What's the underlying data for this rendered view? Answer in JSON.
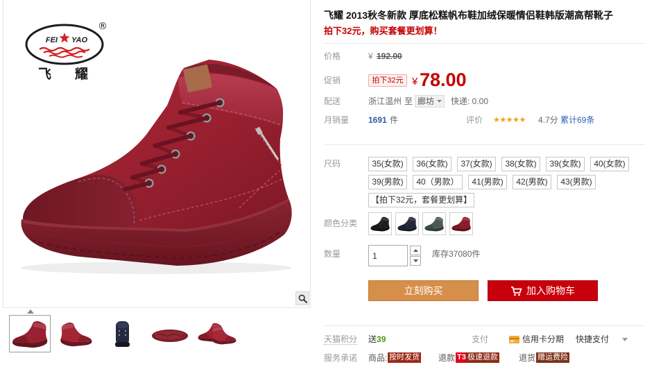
{
  "gallery": {
    "logo": {
      "text_left": "FEI",
      "text_right": "YAO",
      "registered": "®",
      "cn_left": "飞",
      "cn_right": "耀"
    },
    "zoom_icon": "magnifier-icon"
  },
  "product": {
    "title": "飞耀 2013秋冬新款 厚底松糕帆布鞋加绒保暖情侣鞋韩版潮高帮靴子",
    "subtitle": "拍下32元，购买套餐更划算！"
  },
  "price": {
    "label": "价格",
    "currency": "¥",
    "original": "192.00"
  },
  "promo": {
    "label": "促销",
    "badge": "拍下32元",
    "currency": "¥",
    "price": "78.00"
  },
  "delivery": {
    "label": "配送",
    "from": "浙江温州",
    "to": "至",
    "destination": "廊坊",
    "express": "快递: 0.00",
    "dropdown_icon": "chevron-down-icon"
  },
  "sales": {
    "label": "月销量",
    "count": "1691",
    "unit": "件"
  },
  "rating": {
    "label": "评价",
    "stars": "★★★★★",
    "score": "4.7分",
    "reviews": "累计69条"
  },
  "size": {
    "label": "尺码",
    "options": [
      "35(女款)",
      "36(女款)",
      "37(女款)",
      "38(女款)",
      "39(女款)",
      "40(女款)",
      "39(男款)",
      "40（男款）",
      "41(男款)",
      "42(男款)",
      "43(男款)"
    ],
    "package": "【拍下32元，套餐更划算】"
  },
  "color": {
    "label": "颜色分类",
    "swatches": [
      "#1d1d22",
      "#25283c",
      "#4b5a57",
      "#8f1b28"
    ]
  },
  "quantity": {
    "label": "数量",
    "value": "1",
    "stock": "库存37080件"
  },
  "actions": {
    "buy_now": "立刻购买",
    "add_to_cart": "加入购物车",
    "cart_icon": "cart-icon",
    "buy_now_color": "#d68e4b",
    "add_to_cart_color": "#c8000c"
  },
  "points": {
    "label": "天猫积分",
    "prefix": "送",
    "value": "39"
  },
  "payment": {
    "label": "支付",
    "card_icon": "credit-card-icon",
    "installment": "信用卡分期",
    "quick_pay": "快捷支付"
  },
  "service": {
    "label": "服务承诺",
    "goods_label": "商品:",
    "goods_badge": "按时发货",
    "refund_label": "退款:",
    "refund_tag": "T3",
    "refund_badge": "极速退款",
    "return_label": "退货:",
    "return_badge": "赠运费险"
  },
  "theme": {
    "price_red": "#c40000",
    "link_blue": "#2e5fb3",
    "points_green": "#4a9a1a"
  }
}
